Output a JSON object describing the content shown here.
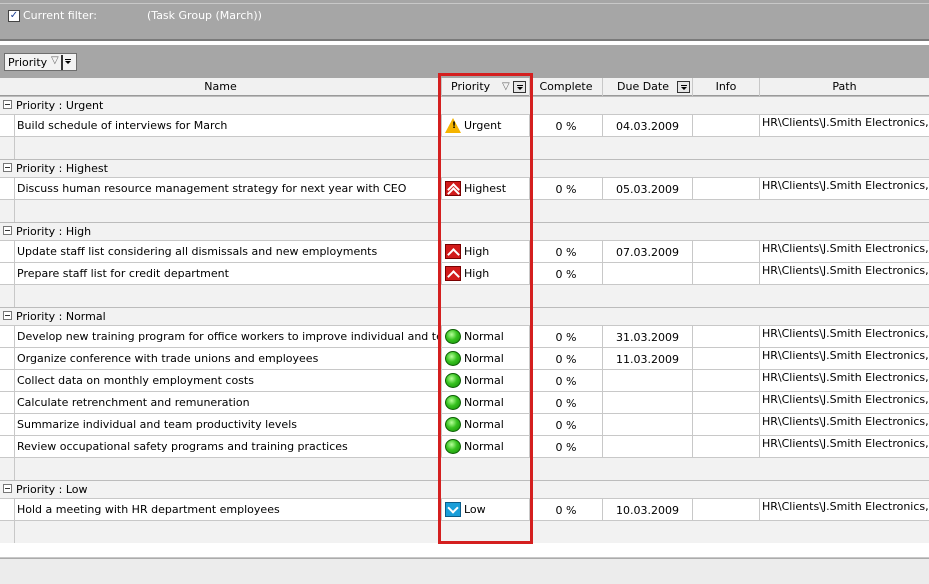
{
  "filter": {
    "checked": true,
    "label": "Current filter:",
    "value": "(Task Group  (March))"
  },
  "group_by": {
    "label": "Priority"
  },
  "columns": {
    "name": "Name",
    "priority": "Priority",
    "complete": "Complete",
    "due_date": "Due Date",
    "info": "Info",
    "path": "Path"
  },
  "groups": [
    {
      "label": "Priority : Urgent",
      "tasks": [
        {
          "name": "Build schedule of interviews for March",
          "priority": "Urgent",
          "icon": "urgent-icon",
          "complete": "0 %",
          "due": "04.03.2009",
          "path": "HR\\Clients\\J.Smith Electronics,"
        }
      ]
    },
    {
      "label": "Priority : Highest",
      "tasks": [
        {
          "name": "Discuss human resource management strategy for next year with CEO",
          "priority": "Highest",
          "icon": "highest-icon",
          "complete": "0 %",
          "due": "05.03.2009",
          "path": "HR\\Clients\\J.Smith Electronics,"
        }
      ]
    },
    {
      "label": "Priority : High",
      "tasks": [
        {
          "name": "Update staff list considering all dismissals and new employments",
          "priority": "High",
          "icon": "high-icon",
          "complete": "0 %",
          "due": "07.03.2009",
          "path": "HR\\Clients\\J.Smith Electronics,"
        },
        {
          "name": "Prepare staff list for credit department",
          "priority": "High",
          "icon": "high-icon",
          "complete": "0 %",
          "due": "",
          "path": "HR\\Clients\\J.Smith Electronics,"
        }
      ]
    },
    {
      "label": "Priority : Normal",
      "tasks": [
        {
          "name": "Develop new training program for office workers to improve individual and team",
          "priority": "Normal",
          "icon": "normal-icon",
          "complete": "0 %",
          "due": "31.03.2009",
          "path": "HR\\Clients\\J.Smith Electronics,"
        },
        {
          "name": "Organize conference with trade unions and employees",
          "priority": "Normal",
          "icon": "normal-icon",
          "complete": "0 %",
          "due": "11.03.2009",
          "path": "HR\\Clients\\J.Smith Electronics,"
        },
        {
          "name": "Collect data on monthly employment costs",
          "priority": "Normal",
          "icon": "normal-icon",
          "complete": "0 %",
          "due": "",
          "path": "HR\\Clients\\J.Smith Electronics,"
        },
        {
          "name": "Calculate retrenchment and remuneration",
          "priority": "Normal",
          "icon": "normal-icon",
          "complete": "0 %",
          "due": "",
          "path": "HR\\Clients\\J.Smith Electronics,"
        },
        {
          "name": "Summarize individual and team productivity levels",
          "priority": "Normal",
          "icon": "normal-icon",
          "complete": "0 %",
          "due": "",
          "path": "HR\\Clients\\J.Smith Electronics,"
        },
        {
          "name": "Review occupational safety programs and training practices",
          "priority": "Normal",
          "icon": "normal-icon",
          "complete": "0 %",
          "due": "",
          "path": "HR\\Clients\\J.Smith Electronics,"
        }
      ]
    },
    {
      "label": "Priority : Low",
      "tasks": [
        {
          "name": "Hold a meeting with HR department employees",
          "priority": "Low",
          "icon": "low-icon",
          "complete": "0 %",
          "due": "10.03.2009",
          "path": "HR\\Clients\\J.Smith Electronics,"
        }
      ]
    }
  ],
  "colors": {
    "toolbar_gray": "#a6a6a6",
    "highlight_red": "#d41f1f",
    "group_row_bg": "#f2f2f2"
  }
}
